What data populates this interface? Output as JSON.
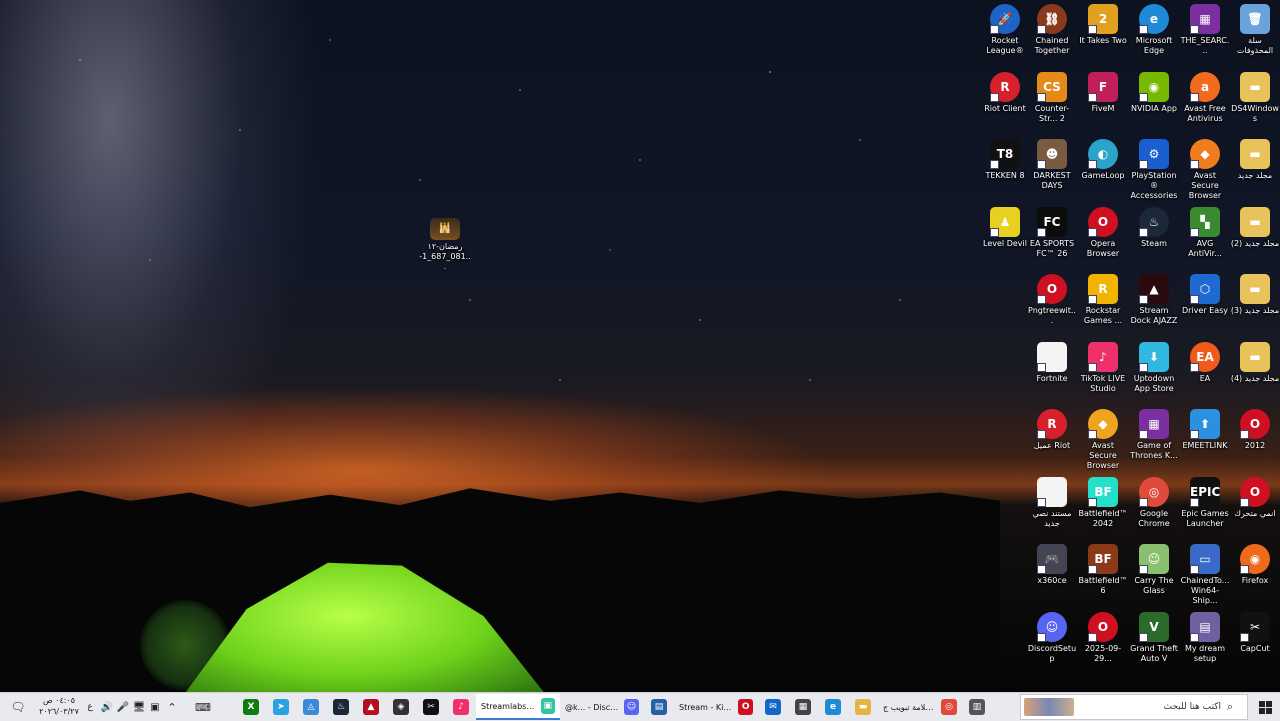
{
  "desktop": {
    "file_icon": {
      "label_line1": "رمضان-١٢",
      "label_line2": "-1_687_081..."
    },
    "icons": [
      {
        "name": "rocket-league",
        "label": "Rocket League®",
        "glyph": "🚀",
        "bg": "#1d64c8",
        "shape": "round"
      },
      {
        "name": "chained-together",
        "label": "Chained Together",
        "glyph": "⛓",
        "bg": "#8a3a1c",
        "shape": "round"
      },
      {
        "name": "it-takes-two",
        "label": "It Takes Two",
        "glyph": "2",
        "bg": "#e0a020",
        "shape": ""
      },
      {
        "name": "microsoft-edge",
        "label": "Microsoft Edge",
        "glyph": "e",
        "bg": "#1f8ad8",
        "shape": "round"
      },
      {
        "name": "the-search",
        "label": "THE_SEARC...",
        "glyph": "▦",
        "bg": "#7b2fa0",
        "shape": ""
      },
      {
        "name": "recycle-bin",
        "label": "سلة المحذوفات",
        "glyph": "🗑",
        "bg": "#6aa3d9",
        "shape": "",
        "noarrow": true
      },
      {
        "name": "riot-client",
        "label": "Riot Client",
        "glyph": "R",
        "bg": "#d8202a",
        "shape": "round"
      },
      {
        "name": "counter-strike",
        "label": "Counter-Str... 2",
        "glyph": "CS",
        "bg": "#e48a18",
        "shape": ""
      },
      {
        "name": "fivem",
        "label": "FiveM",
        "glyph": "F",
        "bg": "#c0205a",
        "shape": ""
      },
      {
        "name": "nvidia-app",
        "label": "NVIDIA App",
        "glyph": "◉",
        "bg": "#76b900",
        "shape": ""
      },
      {
        "name": "avast-free-antivirus",
        "label": "Avast Free Antivirus",
        "glyph": "a",
        "bg": "#f26a1b",
        "shape": "round"
      },
      {
        "name": "ds4windows",
        "label": "DS4Windows",
        "glyph": "▬",
        "bg": "#e8c25a",
        "shape": "",
        "noarrow": true
      },
      {
        "name": "tekken-8",
        "label": "TEKKEN 8",
        "glyph": "T8",
        "bg": "#111",
        "shape": ""
      },
      {
        "name": "darkest-days",
        "label": "DARKEST DAYS",
        "glyph": "☻",
        "bg": "#7a5a40",
        "shape": ""
      },
      {
        "name": "gameloop",
        "label": "GameLoop",
        "glyph": "◐",
        "bg": "#2aa4c8",
        "shape": "round"
      },
      {
        "name": "playstation-accessories",
        "label": "PlayStation® Accessories",
        "glyph": "⚙",
        "bg": "#1a5fd0",
        "shape": ""
      },
      {
        "name": "avast-secure-browser-1",
        "label": "Avast Secure Browser",
        "glyph": "◆",
        "bg": "#f07c1e",
        "shape": "round"
      },
      {
        "name": "new-folder-1",
        "label": "مجلد جديد",
        "glyph": "▬",
        "bg": "#e8c25a",
        "shape": "",
        "noarrow": true
      },
      {
        "name": "level-devil",
        "label": "Level Devil",
        "glyph": "♟",
        "bg": "#e8d020",
        "shape": ""
      },
      {
        "name": "ea-sports-fc-26",
        "label": "EA SPORTS FC™ 26",
        "glyph": "FC",
        "bg": "#0c0c0c",
        "shape": ""
      },
      {
        "name": "opera-browser",
        "label": "Opera Browser",
        "glyph": "O",
        "bg": "#d01020",
        "shape": "round"
      },
      {
        "name": "steam",
        "label": "Steam",
        "glyph": "♨",
        "bg": "#1b2838",
        "shape": "round"
      },
      {
        "name": "avg-antivirus",
        "label": "AVG AntiVir...",
        "glyph": "▚",
        "bg": "#3a8a30",
        "shape": ""
      },
      {
        "name": "new-folder-2",
        "label": "(2) مجلد جديد",
        "glyph": "▬",
        "bg": "#e8c25a",
        "shape": "",
        "noarrow": true
      },
      {
        "name": "pngtreewit",
        "label": "Pngtreewit...",
        "glyph": "O",
        "bg": "#d01020",
        "shape": "round"
      },
      {
        "name": "rockstar-games",
        "label": "Rockstar Games ...",
        "glyph": "R",
        "bg": "#f2b400",
        "shape": ""
      },
      {
        "name": "stream-dock-ajazz",
        "label": "Stream Dock AJAZZ",
        "glyph": "▲",
        "bg": "#2a0a0e",
        "shape": ""
      },
      {
        "name": "driver-easy",
        "label": "Driver Easy",
        "glyph": "⬡",
        "bg": "#1e6ad0",
        "shape": ""
      },
      {
        "name": "new-folder-3",
        "label": "(3) مجلد جديد",
        "glyph": "▬",
        "bg": "#e8c25a",
        "shape": "",
        "noarrow": true
      },
      {
        "name": "fortnite",
        "label": "Fortnite",
        "glyph": "",
        "bg": "#f4f4f4",
        "shape": ""
      },
      {
        "name": "tiktok-live-studio",
        "label": "TikTok LIVE Studio",
        "glyph": "♪",
        "bg": "#f0306a",
        "shape": ""
      },
      {
        "name": "uptodown-app-store",
        "label": "Uptodown App Store",
        "glyph": "⬇",
        "bg": "#30b8e0",
        "shape": ""
      },
      {
        "name": "ea",
        "label": "EA",
        "glyph": "EA",
        "bg": "#f05a1c",
        "shape": "round"
      },
      {
        "name": "new-folder-4",
        "label": "(4) مجلد جديد",
        "glyph": "▬",
        "bg": "#e8c25a",
        "shape": "",
        "noarrow": true
      },
      {
        "name": "riot-client-ar",
        "label": "عميل Riot",
        "glyph": "R",
        "bg": "#d8202a",
        "shape": "round"
      },
      {
        "name": "avast-secure-browser-2",
        "label": "Avast Secure Browser",
        "glyph": "◆",
        "bg": "#f0a41e",
        "shape": "round"
      },
      {
        "name": "game-of-thrones",
        "label": "Game of Thrones K...",
        "glyph": "▦",
        "bg": "#7b2fa0",
        "shape": ""
      },
      {
        "name": "emeetlink",
        "label": "EMEETLINK",
        "glyph": "⬆",
        "bg": "#2b90e0",
        "shape": ""
      },
      {
        "name": "opera-2012",
        "label": "2012",
        "glyph": "O",
        "bg": "#d01020",
        "shape": "round"
      },
      {
        "name": "new-text-document",
        "label": "مستند نصي جديد",
        "glyph": "",
        "bg": "#f4f4f4",
        "shape": ""
      },
      {
        "name": "battlefield-2042",
        "label": "Battlefield™ 2042",
        "glyph": "BF",
        "bg": "#24e0c8",
        "shape": ""
      },
      {
        "name": "google-chrome",
        "label": "Google Chrome",
        "glyph": "◎",
        "bg": "#e04a3a",
        "shape": "round"
      },
      {
        "name": "epic-games-launcher",
        "label": "Epic Games Launcher",
        "glyph": "EPIC",
        "bg": "#111",
        "shape": ""
      },
      {
        "name": "opera-ar",
        "label": "انمي متحرك",
        "glyph": "O",
        "bg": "#d01020",
        "shape": "round"
      },
      {
        "name": "x360ce",
        "label": "x360ce",
        "glyph": "🎮",
        "bg": "#445",
        "shape": ""
      },
      {
        "name": "battlefield-6",
        "label": "Battlefield™ 6",
        "glyph": "BF",
        "bg": "#8a3a18",
        "shape": ""
      },
      {
        "name": "carry-the-glass",
        "label": "Carry The Glass",
        "glyph": "☺",
        "bg": "#88c070",
        "shape": ""
      },
      {
        "name": "chainedtogether-shipping",
        "label": "ChainedTo... Win64-Ship...",
        "glyph": "▭",
        "bg": "#3a6ac8",
        "shape": ""
      },
      {
        "name": "firefox",
        "label": "Firefox",
        "glyph": "◉",
        "bg": "#f06a1c",
        "shape": "round"
      },
      {
        "name": "discord-setup",
        "label": "DiscordSetup",
        "glyph": "☺",
        "bg": "#5865f2",
        "shape": "round"
      },
      {
        "name": "opera-2025",
        "label": "2025-09-29...",
        "glyph": "O",
        "bg": "#d01020",
        "shape": "round"
      },
      {
        "name": "gta-v",
        "label": "Grand Theft Auto V",
        "glyph": "V",
        "bg": "#2a6a2a",
        "shape": ""
      },
      {
        "name": "my-dream-setup",
        "label": "My dream setup",
        "glyph": "▤",
        "bg": "#7060a0",
        "shape": ""
      },
      {
        "name": "capcut",
        "label": "CapCut",
        "glyph": "✂",
        "bg": "#111",
        "shape": ""
      }
    ]
  },
  "taskbar": {
    "search_placeholder": "اكتب هنا للبحث",
    "clock_time": "٠٤:٠٥ ص",
    "clock_date": "٢٠٢٦/٠٣/٢٧",
    "lang": "ع",
    "apps": [
      {
        "name": "taskview",
        "glyph": "▥",
        "bg": "#555"
      },
      {
        "name": "chrome-window",
        "title": "علامة تبويب ج...",
        "glyph": "◎",
        "bg": "#e04a3a",
        "active": false
      },
      {
        "name": "file-explorer",
        "glyph": "▬",
        "bg": "#e8b440"
      },
      {
        "name": "edge",
        "glyph": "e",
        "bg": "#1f8ad8"
      },
      {
        "name": "store",
        "glyph": "▦",
        "bg": "#444"
      },
      {
        "name": "outlook",
        "glyph": "✉",
        "bg": "#1467c8"
      },
      {
        "name": "opera-kick",
        "title": "Stream - Kick...",
        "glyph": "O",
        "bg": "#d01020",
        "active": false
      },
      {
        "name": "app-blue",
        "glyph": "▤",
        "bg": "#2860a8"
      },
      {
        "name": "discord-window",
        "title": "@k... - Discord",
        "glyph": "☺",
        "bg": "#5865f2",
        "active": false
      },
      {
        "name": "streamlabs",
        "title": "Streamlabs D...",
        "glyph": "▣",
        "bg": "#31c3a2",
        "active": true
      },
      {
        "name": "tiktok",
        "glyph": "♪",
        "bg": "#f0306a"
      },
      {
        "name": "capcut-tb",
        "glyph": "✂",
        "bg": "#111"
      },
      {
        "name": "davinci",
        "glyph": "◈",
        "bg": "#333"
      },
      {
        "name": "ajazz",
        "glyph": "▲",
        "bg": "#b01020"
      },
      {
        "name": "steam-tb",
        "glyph": "♨",
        "bg": "#1b2838"
      },
      {
        "name": "app-azure",
        "glyph": "◬",
        "bg": "#3a8ad8"
      },
      {
        "name": "telegram",
        "glyph": "➤",
        "bg": "#2aa2e0"
      },
      {
        "name": "xbox",
        "glyph": "X",
        "bg": "#107c10"
      }
    ]
  }
}
